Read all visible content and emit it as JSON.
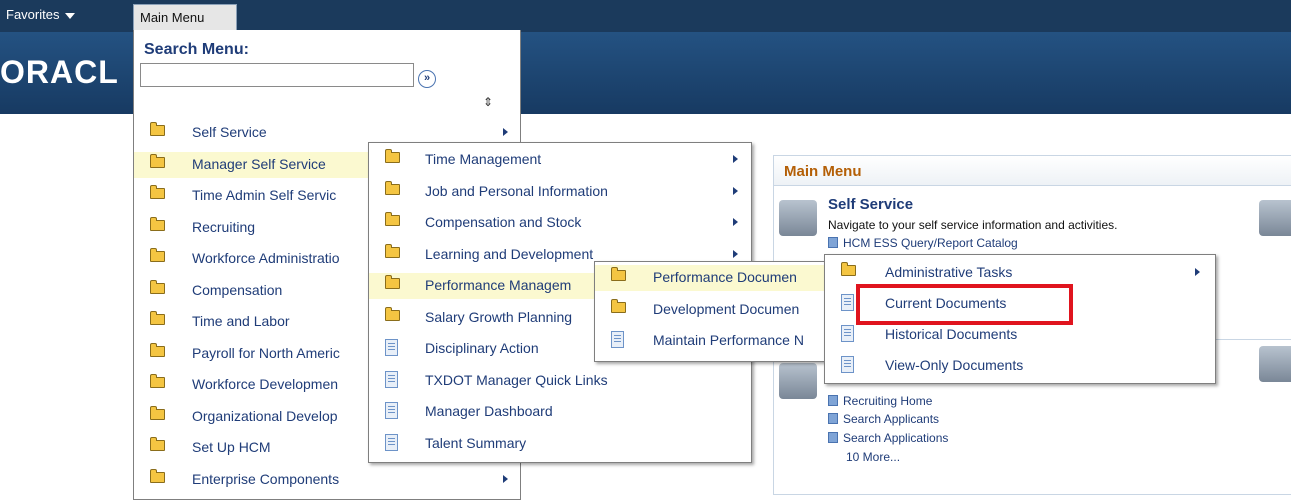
{
  "topbar": {
    "favorites": "Favorites",
    "main_menu": "Main Menu"
  },
  "banner": {
    "logo_text": "ORACL"
  },
  "search": {
    "label": "Search Menu:",
    "value": ""
  },
  "main_menu_items": [
    {
      "label": "Self Service",
      "icon": "folder-icon",
      "arrow": true
    },
    {
      "label": "Manager Self Service",
      "icon": "folder-icon",
      "arrow": false
    },
    {
      "label": "Time Admin Self Servic",
      "icon": "folder-icon",
      "arrow": false
    },
    {
      "label": "Recruiting",
      "icon": "folder-icon",
      "arrow": false
    },
    {
      "label": "Workforce Administratio",
      "icon": "folder-icon",
      "arrow": false
    },
    {
      "label": "Compensation",
      "icon": "folder-icon",
      "arrow": false
    },
    {
      "label": "Time and Labor",
      "icon": "folder-icon",
      "arrow": false
    },
    {
      "label": "Payroll for North Americ",
      "icon": "folder-icon",
      "arrow": false
    },
    {
      "label": "Workforce Developmen",
      "icon": "folder-icon",
      "arrow": false
    },
    {
      "label": "Organizational Develop",
      "icon": "folder-icon",
      "arrow": false
    },
    {
      "label": "Set Up HCM",
      "icon": "folder-icon",
      "arrow": false
    },
    {
      "label": "Enterprise Components",
      "icon": "folder-icon",
      "arrow": true
    }
  ],
  "manager_menu_items": [
    {
      "label": "Time Management",
      "icon": "folder-icon",
      "arrow": true
    },
    {
      "label": "Job and Personal Information",
      "icon": "folder-icon",
      "arrow": true
    },
    {
      "label": "Compensation and Stock",
      "icon": "folder-icon",
      "arrow": true
    },
    {
      "label": "Learning and Development",
      "icon": "folder-icon",
      "arrow": true
    },
    {
      "label": "Performance Managem",
      "icon": "folder-icon",
      "arrow": false
    },
    {
      "label": "Salary Growth Planning",
      "icon": "folder-icon",
      "arrow": false
    },
    {
      "label": "Disciplinary Action",
      "icon": "document-icon",
      "arrow": false
    },
    {
      "label": "TXDOT Manager Quick Links",
      "icon": "document-icon",
      "arrow": false
    },
    {
      "label": "Manager Dashboard",
      "icon": "document-icon",
      "arrow": false
    },
    {
      "label": "Talent Summary",
      "icon": "document-icon",
      "arrow": false
    }
  ],
  "performance_menu_items": [
    {
      "label": "Performance Documen",
      "icon": "folder-icon",
      "arrow": false
    },
    {
      "label": "Development Documen",
      "icon": "folder-icon",
      "arrow": false
    },
    {
      "label": "Maintain Performance N",
      "icon": "document-icon",
      "arrow": false
    }
  ],
  "documents_menu_items": [
    {
      "label": "Administrative Tasks",
      "icon": "folder-icon",
      "arrow": true
    },
    {
      "label": "Current Documents",
      "icon": "document-icon",
      "arrow": false
    },
    {
      "label": "Historical Documents",
      "icon": "document-icon",
      "arrow": false
    },
    {
      "label": "View-Only Documents",
      "icon": "document-icon",
      "arrow": false
    }
  ],
  "main_panel": {
    "title": "Main Menu",
    "self_service_title": "Self Service",
    "self_service_desc": "Navigate to your self service information and activities.",
    "catalog_link": "HCM ESS Query/Report Catalog",
    "recruiting_links": [
      "Recruiting Home",
      "Search Applicants",
      "Search Applications"
    ],
    "more_link": "10 More..."
  },
  "highlight": {
    "target": "Current Documents",
    "color": "#e0141e"
  }
}
